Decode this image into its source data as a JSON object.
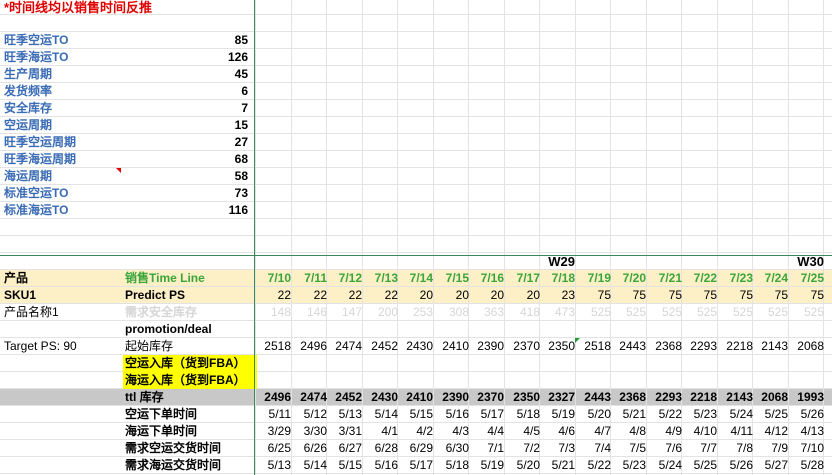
{
  "note": "*时间线均以销售时间反推",
  "params": [
    {
      "label": "旺季空运TO",
      "value": "85"
    },
    {
      "label": "旺季海运TO",
      "value": "126"
    },
    {
      "label": "生产周期",
      "value": "45"
    },
    {
      "label": "发货频率",
      "value": "6"
    },
    {
      "label": "安全库存",
      "value": "7"
    },
    {
      "label": "空运周期",
      "value": "15"
    },
    {
      "label": "旺季空运周期",
      "value": "27"
    },
    {
      "label": "旺季海运周期",
      "value": "68"
    },
    {
      "label": "海运周期",
      "value": "58"
    },
    {
      "label": "标准空运TO",
      "value": "73"
    },
    {
      "label": "标准海运TO",
      "value": "116"
    }
  ],
  "weeks": [
    {
      "label": "W29",
      "col": 8
    },
    {
      "label": "W30",
      "col": 15
    }
  ],
  "header": {
    "product": "产品",
    "timeline": "销售Time Line"
  },
  "dates": [
    "7/10",
    "7/11",
    "7/12",
    "7/13",
    "7/14",
    "7/15",
    "7/16",
    "7/17",
    "7/18",
    "7/19",
    "7/20",
    "7/21",
    "7/22",
    "7/23",
    "7/24",
    "7/25"
  ],
  "rows": {
    "predict": {
      "a": "SKU1",
      "b": "Predict PS",
      "vals": [
        "22",
        "22",
        "22",
        "22",
        "20",
        "20",
        "20",
        "20",
        "23",
        "75",
        "75",
        "75",
        "75",
        "75",
        "75",
        "75"
      ]
    },
    "safety": {
      "a": "产品名称1",
      "b": "需求安全库存",
      "vals": [
        "148",
        "146",
        "147",
        "200",
        "253",
        "308",
        "363",
        "418",
        "473",
        "525",
        "525",
        "525",
        "525",
        "525",
        "525",
        "525"
      ]
    },
    "promo": {
      "a": "",
      "b": "promotion/deal"
    },
    "start": {
      "a": "Target PS: 90",
      "b": "起始库存",
      "vals": [
        "2518",
        "2496",
        "2474",
        "2452",
        "2430",
        "2410",
        "2390",
        "2370",
        "2350",
        "2518",
        "2443",
        "2368",
        "2293",
        "2218",
        "2143",
        "2068"
      ]
    },
    "air_in": {
      "b": "空运入库（货到FBA）"
    },
    "sea_in": {
      "b": "海运入库（货到FBA）"
    },
    "ttl": {
      "b": "ttl 库存",
      "vals": [
        "2496",
        "2474",
        "2452",
        "2430",
        "2410",
        "2390",
        "2370",
        "2350",
        "2327",
        "2443",
        "2368",
        "2293",
        "2218",
        "2143",
        "2068",
        "1993"
      ]
    },
    "air_order": {
      "b": "空运下单时间",
      "vals": [
        "5/11",
        "5/12",
        "5/13",
        "5/14",
        "5/15",
        "5/16",
        "5/17",
        "5/18",
        "5/19",
        "5/20",
        "5/21",
        "5/22",
        "5/23",
        "5/24",
        "5/25",
        "5/26"
      ]
    },
    "sea_order": {
      "b": "海运下单时间",
      "vals": [
        "3/29",
        "3/30",
        "3/31",
        "4/1",
        "4/2",
        "4/3",
        "4/4",
        "4/5",
        "4/6",
        "4/7",
        "4/8",
        "4/9",
        "4/10",
        "4/11",
        "4/12",
        "4/13"
      ]
    },
    "air_deliv": {
      "b": "需求空运交货时间",
      "vals": [
        "6/25",
        "6/26",
        "6/27",
        "6/28",
        "6/29",
        "6/30",
        "7/1",
        "7/2",
        "7/3",
        "7/4",
        "7/5",
        "7/6",
        "7/7",
        "7/8",
        "7/9",
        "7/10"
      ]
    },
    "sea_deliv": {
      "b": "需求海运交货时间",
      "vals": [
        "5/13",
        "5/14",
        "5/15",
        "5/16",
        "5/17",
        "5/18",
        "5/19",
        "5/20",
        "5/21",
        "5/22",
        "5/23",
        "5/24",
        "5/25",
        "5/26",
        "5/27",
        "5/28"
      ]
    }
  },
  "colors": {
    "param_label": "#3a6bb5",
    "note": "#e00000",
    "band": "#fdefc6",
    "green": "#3aa53a",
    "ttl_bg": "#c8c8c8",
    "yellow": "#ffff00",
    "muted": "#d6d6d6"
  }
}
